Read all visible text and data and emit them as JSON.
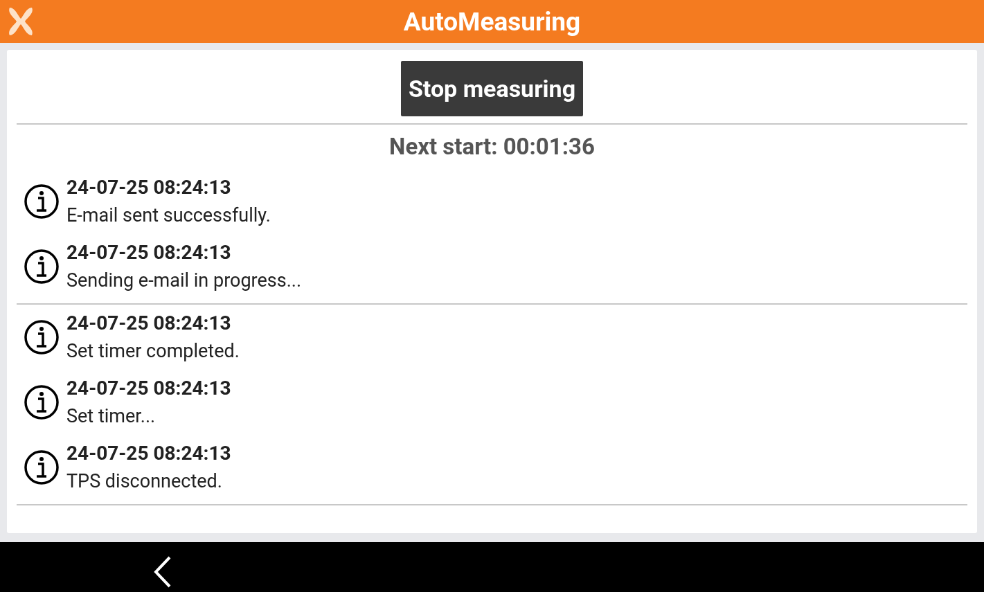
{
  "app_bar": {
    "title": "AutoMeasuring"
  },
  "stop_button": {
    "label": "Stop measuring"
  },
  "next_start": "Next start: 00:01:36",
  "log_groups": [
    [
      {
        "kind": "info",
        "time": "24-07-25 08:24:13",
        "message": "E-mail sent successfully."
      },
      {
        "kind": "info",
        "time": "24-07-25 08:24:13",
        "message": "Sending e-mail in progress..."
      }
    ],
    [
      {
        "kind": "info",
        "time": "24-07-25 08:24:13",
        "message": "Set timer completed."
      },
      {
        "kind": "info",
        "time": "24-07-25 08:24:13",
        "message": "Set timer..."
      },
      {
        "kind": "info",
        "time": "24-07-25 08:24:13",
        "message": "TPS disconnected."
      }
    ]
  ]
}
